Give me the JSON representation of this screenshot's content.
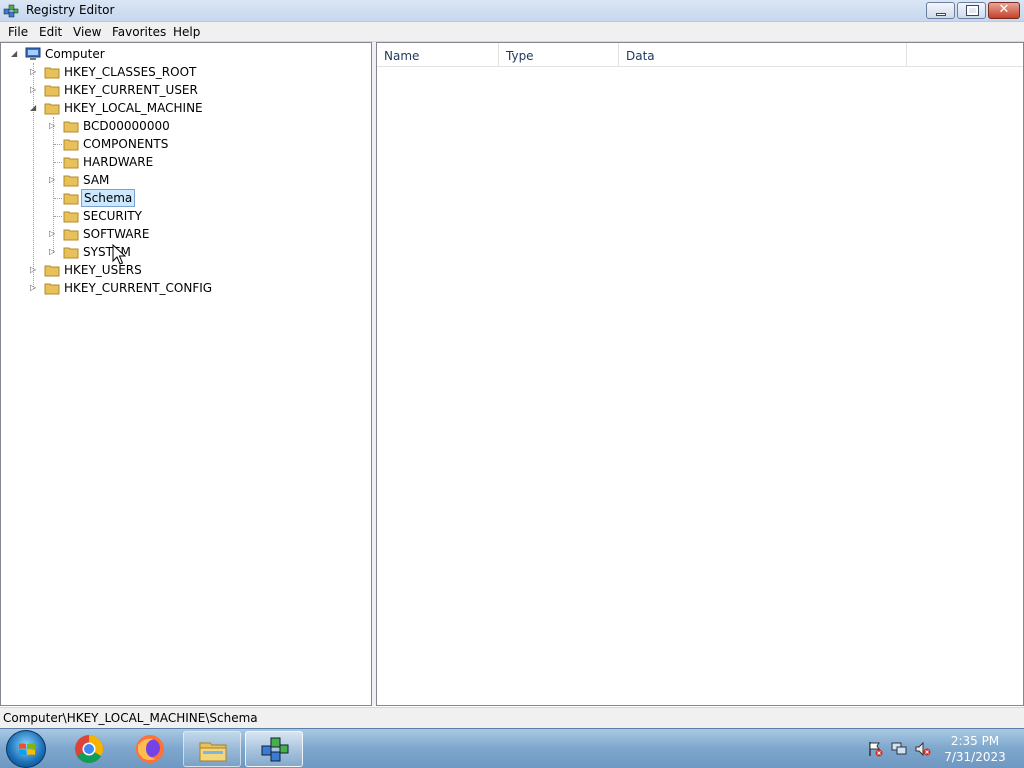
{
  "window": {
    "title": "Registry Editor",
    "controls": {
      "minimize": "minimize-icon",
      "maximize": "restore-icon",
      "close": "close-icon"
    }
  },
  "menu": [
    "File",
    "Edit",
    "View",
    "Favorites",
    "Help"
  ],
  "tree": {
    "root": "Computer",
    "hives": [
      {
        "label": "HKEY_CLASSES_ROOT",
        "expandable": true,
        "expanded": false
      },
      {
        "label": "HKEY_CURRENT_USER",
        "expandable": true,
        "expanded": false
      },
      {
        "label": "HKEY_LOCAL_MACHINE",
        "expandable": true,
        "expanded": true,
        "children": [
          {
            "label": "BCD00000000",
            "expandable": true
          },
          {
            "label": "COMPONENTS",
            "expandable": false
          },
          {
            "label": "HARDWARE",
            "expandable": false
          },
          {
            "label": "SAM",
            "expandable": true
          },
          {
            "label": "Schema",
            "expandable": false,
            "selected": true
          },
          {
            "label": "SECURITY",
            "expandable": false
          },
          {
            "label": "SOFTWARE",
            "expandable": true
          },
          {
            "label": "SYSTEM",
            "expandable": true
          }
        ]
      },
      {
        "label": "HKEY_USERS",
        "expandable": true,
        "expanded": false
      },
      {
        "label": "HKEY_CURRENT_CONFIG",
        "expandable": true,
        "expanded": false
      }
    ]
  },
  "list": {
    "columns": [
      "Name",
      "Type",
      "Data"
    ],
    "rows": []
  },
  "status": {
    "path": "Computer\\HKEY_LOCAL_MACHINE\\Schema"
  },
  "taskbar": {
    "apps": [
      "chrome-icon",
      "firefox-icon",
      "file-explorer-icon",
      "registry-editor-icon"
    ],
    "tray": [
      "action-center-icon",
      "network-icon",
      "volume-muted-icon"
    ],
    "time": "2:35 PM",
    "date": "7/31/2023"
  },
  "colors": {
    "selection": "#cce8ff",
    "selection_border": "#7da2ce",
    "folder": "#e8c15a"
  }
}
